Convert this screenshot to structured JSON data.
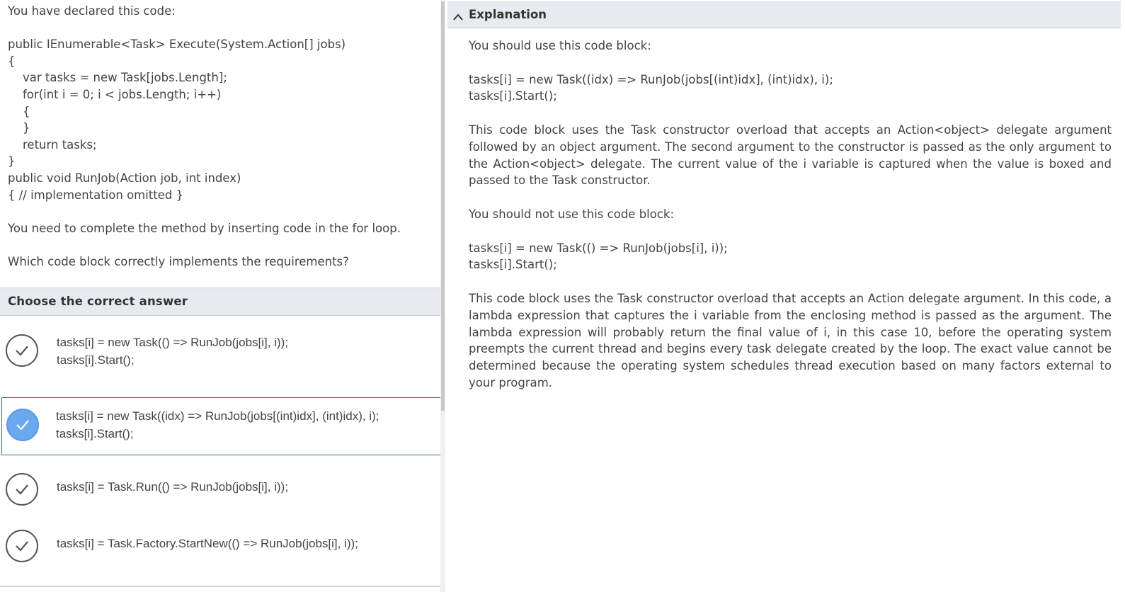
{
  "question": {
    "intro": "You have declared this code:",
    "code_lines": [
      "public IEnumerable<Task> Execute(System.Action[] jobs)",
      "{",
      "var tasks = new Task[jobs.Length];",
      "for(int i = 0; i < jobs.Length; i++)",
      "{",
      "}",
      "return tasks;",
      "}",
      "public void RunJob(Action job, int index)",
      "{ // implementation omitted }"
    ],
    "instruction": "You need to complete the method by inserting code in the for loop.",
    "prompt": "Which code block correctly implements the requirements?"
  },
  "answers": {
    "header": "Choose the correct answer",
    "options": [
      {
        "line1": "tasks[i] = new Task(() => RunJob(jobs[i], i));",
        "line2": "tasks[i].Start();",
        "selected": false
      },
      {
        "line1": "tasks[i] = new Task((idx) => RunJob(jobs[(int)idx], (int)idx), i);",
        "line2": "tasks[i].Start();",
        "selected": true
      },
      {
        "line1": "tasks[i] = Task.Run(() => RunJob(jobs[i], i));",
        "line2": "",
        "selected": false
      },
      {
        "line1": "tasks[i] = Task.Factory.StartNew(() => RunJob(jobs[i], i));",
        "line2": "",
        "selected": false
      }
    ]
  },
  "explanation": {
    "title": "Explanation",
    "use_intro": "You should use this code block:",
    "use_code_1": "tasks[i] = new Task((idx) => RunJob(jobs[(int)idx], (int)idx), i);",
    "use_code_2": "tasks[i].Start();",
    "use_para": "This code block uses the Task constructor overload that accepts an Action<object> delegate argument followed by an object argument. The second argument to the constructor is passed as the only argument to the Action<object> delegate. The current value of the i variable is captured when the value is boxed and passed to the Task constructor.",
    "not_use_intro": "You should not use this code block:",
    "not_use_code_1": "tasks[i] = new Task(() => RunJob(jobs[i], i));",
    "not_use_code_2": "tasks[i].Start();",
    "not_use_para": "This code block uses the Task constructor overload that accepts an Action delegate argument. In this code, a lambda expression that captures the i variable from the enclosing method is passed as the argument. The lambda expression will probably return the final value of i, in this case 10, before the operating system preempts the current thread and begins every task delegate created by the loop. The exact value cannot be determined because the operating system schedules thread execution based on many factors external to your program."
  },
  "colors": {
    "header_bg": "#e7ebf0",
    "selected_fill": "#6aa8f0",
    "selected_border": "#2e7d4a",
    "text": "#444444"
  },
  "icons": {
    "option_check": "check-icon",
    "collapse": "chevron-up-icon"
  }
}
